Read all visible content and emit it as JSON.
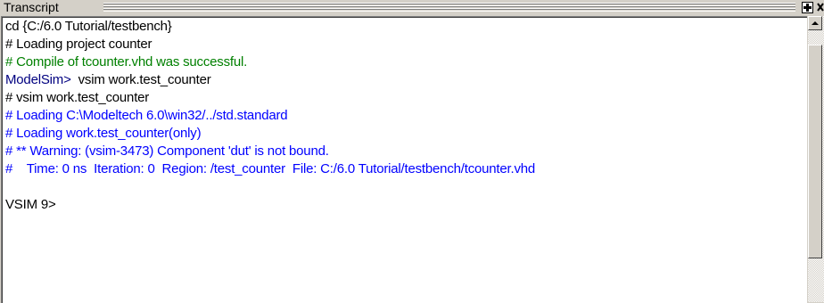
{
  "panel": {
    "title": "Transcript"
  },
  "colors": {
    "default": "#000000",
    "success": "#008000",
    "info": "#0000ff",
    "prompt": "#000080"
  },
  "transcript": {
    "lines": [
      {
        "text": "cd {C:/6.0 Tutorial/testbench}",
        "style": "default"
      },
      {
        "text": "# Loading project counter",
        "style": "default"
      },
      {
        "text": "# Compile of tcounter.vhd was successful.",
        "style": "success"
      },
      {
        "prompt": "ModelSim>",
        "text": "vsim work.test_counter",
        "style": "default"
      },
      {
        "text": "# vsim work.test_counter",
        "style": "default"
      },
      {
        "text": "# Loading C:\\Modeltech 6.0\\win32/../std.standard",
        "style": "info"
      },
      {
        "text": "# Loading work.test_counter(only)",
        "style": "info"
      },
      {
        "text": "# ** Warning: (vsim-3473) Component 'dut' is not bound.",
        "style": "info"
      },
      {
        "text": "#    Time: 0 ns  Iteration: 0  Region: /test_counter  File: C:/6.0 Tutorial/testbench/tcounter.vhd",
        "style": "info"
      },
      {
        "text": "",
        "style": "default"
      },
      {
        "text": "VSIM 9>",
        "style": "default"
      }
    ]
  },
  "icons": {
    "dock": "plus-icon",
    "scroll_up": "arrow-up-icon"
  }
}
